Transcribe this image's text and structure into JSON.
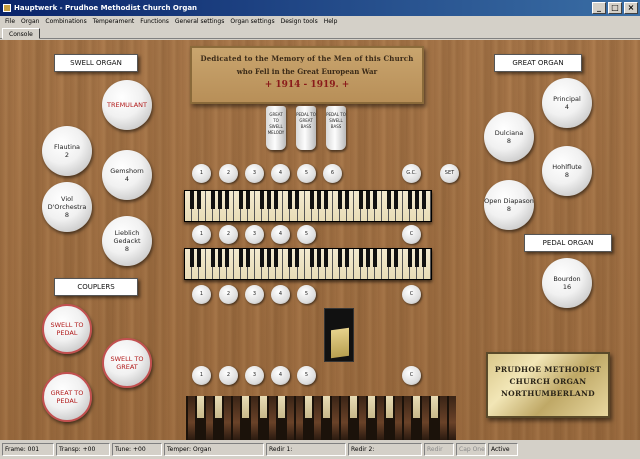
{
  "window": {
    "title": "Hauptwerk - Prudhoe Methodist Church Organ",
    "buttons": [
      "_",
      "□",
      "×"
    ]
  },
  "menu": [
    "File",
    "Organ",
    "Combinations",
    "Temperament",
    "Functions",
    "General settings",
    "Organ settings",
    "Design tools",
    "Help"
  ],
  "tabs": [
    "Console"
  ],
  "sections": {
    "swell": "SWELL ORGAN",
    "couplers": "COUPLERS",
    "great": "GREAT ORGAN",
    "pedal": "PEDAL ORGAN"
  },
  "memorial": {
    "line1": "Dedicated to the Memory of the Men of this Church",
    "line2": "who Fell in the Great European War",
    "line3": "+ 1914 - 1919. +"
  },
  "swell_stops": [
    {
      "name": "TREMULANT",
      "pitch": ""
    },
    {
      "name": "Flautina",
      "pitch": "2"
    },
    {
      "name": "Gemshorn",
      "pitch": "4"
    },
    {
      "name": "Viol D'Orchestra",
      "pitch": "8"
    },
    {
      "name": "Lieblich Gedackt",
      "pitch": "8"
    }
  ],
  "couplers": [
    "SWELL TO PEDAL",
    "SWELL TO GREAT",
    "GREAT TO PEDAL"
  ],
  "coupler_tabs": [
    "GREAT TO SWELL MELODY",
    "PEDAL TO GREAT BASS",
    "PEDAL TO SWELL BASS"
  ],
  "great_stops": [
    {
      "name": "Principal",
      "pitch": "4"
    },
    {
      "name": "Dulciana",
      "pitch": "8"
    },
    {
      "name": "Hohlflute",
      "pitch": "8"
    },
    {
      "name": "Open Diapason",
      "pitch": "8"
    }
  ],
  "pedal_stops": [
    {
      "name": "Bourdon",
      "pitch": "16"
    }
  ],
  "pistons": {
    "top_row": [
      "1",
      "2",
      "3",
      "4",
      "5",
      "6"
    ],
    "gc": "G.C.",
    "set": "SET",
    "row": [
      "1",
      "2",
      "3",
      "4",
      "5"
    ],
    "cancel": "C"
  },
  "plaque": [
    "PRUDHOE METHODIST",
    "CHURCH ORGAN",
    "NORTHUMBERLAND"
  ],
  "status": {
    "frame": "Frame: 001",
    "transp": "Transp: +00",
    "tune": "Tune: +00",
    "temper": "Temper: Organ",
    "redir1": "Redir 1:",
    "redir2": "Redir 2:",
    "redir": "Redir",
    "capone": "Cap One",
    "active": "Active"
  }
}
